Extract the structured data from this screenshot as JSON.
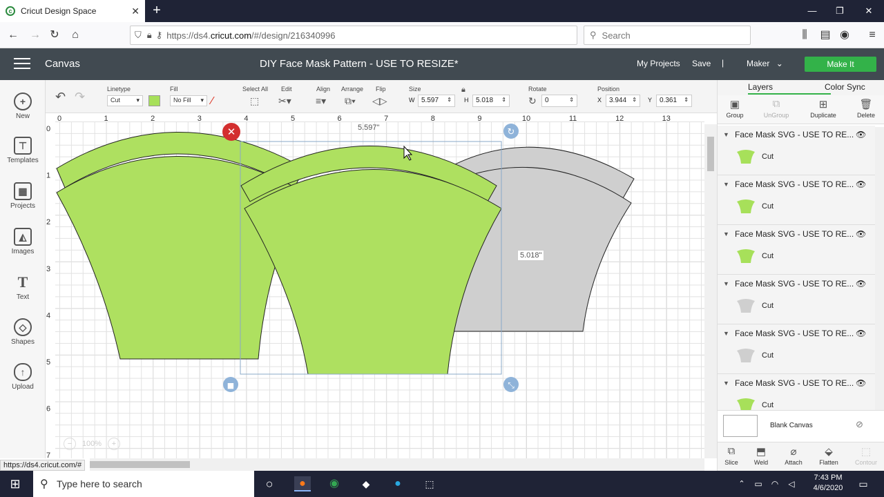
{
  "browser": {
    "tab_title": "Cricut Design Space",
    "tab_close": "✕",
    "new_tab": "+",
    "url_prefix": "https://ds4.",
    "url_domain": "cricut.com",
    "url_path": "/#/design/216340996",
    "search_placeholder": "Search",
    "status_url": "https://ds4.cricut.com/#"
  },
  "app": {
    "section": "Canvas",
    "project_title": "DIY Face Mask Pattern - USE TO RESIZE*",
    "my_projects": "My Projects",
    "save": "Save",
    "separator": "|",
    "machine": "Maker",
    "make_it": "Make It",
    "accent_color": "#33b249"
  },
  "sidebar": {
    "items": [
      {
        "label": "New",
        "icon": "plus-icon"
      },
      {
        "label": "Templates",
        "icon": "shirt-icon"
      },
      {
        "label": "Projects",
        "icon": "projects-icon"
      },
      {
        "label": "Images",
        "icon": "image-icon"
      },
      {
        "label": "Text",
        "icon": "text-icon"
      },
      {
        "label": "Shapes",
        "icon": "shapes-icon"
      },
      {
        "label": "Upload",
        "icon": "upload-icon"
      }
    ]
  },
  "toolbar": {
    "linetype_label": "Linetype",
    "linetype_value": "Cut",
    "fill_label": "Fill",
    "fill_value": "No Fill",
    "select_all": "Select All",
    "edit": "Edit",
    "align": "Align",
    "arrange": "Arrange",
    "flip": "Flip",
    "size_label": "Size",
    "w_label": "W",
    "w_value": "5.597",
    "h_label": "H",
    "h_value": "5.018",
    "rotate_label": "Rotate",
    "rotate_value": "0",
    "position_label": "Position",
    "x_label": "X",
    "x_value": "3.944",
    "y_label": "Y",
    "y_value": "0.361",
    "swatch_color": "#a7e05a"
  },
  "canvas": {
    "ruler_x": [
      "0",
      "1",
      "2",
      "3",
      "4",
      "5",
      "6",
      "7",
      "8",
      "9",
      "10",
      "11",
      "12",
      "13"
    ],
    "ruler_y": [
      "0",
      "1",
      "2",
      "3",
      "4",
      "5",
      "6",
      "7"
    ],
    "width_readout": "5.597\"",
    "height_readout": "5.018\"",
    "zoom": "100%",
    "zoom_minus": "−",
    "zoom_plus": "+",
    "green": "#aee060",
    "gray": "#cfcfcf"
  },
  "panel": {
    "tab_layers": "Layers",
    "tab_color_sync": "Color Sync",
    "actions": [
      "Group",
      "UnGroup",
      "Duplicate",
      "Delete"
    ],
    "layers": [
      {
        "name": "Face Mask SVG - USE TO RE...",
        "op": "Cut",
        "color": "#a7e05a"
      },
      {
        "name": "Face Mask SVG - USE TO RE...",
        "op": "Cut",
        "color": "#a7e05a"
      },
      {
        "name": "Face Mask SVG - USE TO RE...",
        "op": "Cut",
        "color": "#a7e05a"
      },
      {
        "name": "Face Mask SVG - USE TO RE...",
        "op": "Cut",
        "color": "#cfcfcf"
      },
      {
        "name": "Face Mask SVG - USE TO RE...",
        "op": "Cut",
        "color": "#cfcfcf"
      },
      {
        "name": "Face Mask SVG - USE TO RE...",
        "op": "Cut",
        "color": "#a7e05a"
      }
    ],
    "blank_canvas": "Blank Canvas",
    "bottom_actions": [
      "Slice",
      "Weld",
      "Attach",
      "Flatten",
      "Contour"
    ]
  },
  "taskbar": {
    "search_placeholder": "Type here to search",
    "time": "7:43 PM",
    "date": "4/6/2020"
  }
}
